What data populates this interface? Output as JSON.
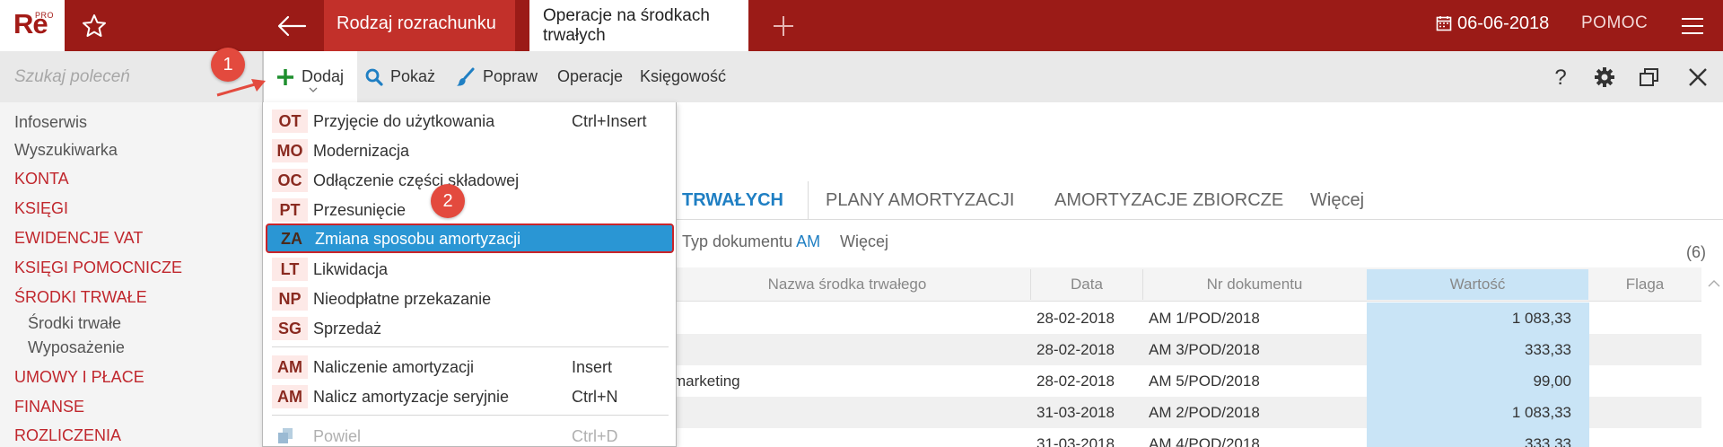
{
  "app": {
    "logo_text": "Re",
    "logo_badge": "PRO",
    "tabs": [
      {
        "label": "Rodzaj rozrachunku"
      },
      {
        "label": "Operacje na środkach trwałych"
      }
    ],
    "date": "06-06-2018",
    "help_label": "POMOC",
    "accent_color": "#9b1b17"
  },
  "toolbar": {
    "search_placeholder": "Szukaj poleceń",
    "add_label": "Dodaj",
    "show_label": "Pokaż",
    "edit_label": "Popraw",
    "operations_label": "Operacje",
    "accounting_label": "Księgowość"
  },
  "sidebar": {
    "items": [
      {
        "label": "Infoserwis"
      },
      {
        "label": "Wyszukiwarka"
      },
      {
        "label": "KONTA"
      },
      {
        "label": "KSIĘGI"
      },
      {
        "label": "EWIDENCJE VAT"
      },
      {
        "label": "KSIĘGI POMOCNICZE"
      },
      {
        "label": "ŚRODKI TRWAŁE"
      },
      {
        "label": "Środki trwałe"
      },
      {
        "label": "Wyposażenie"
      },
      {
        "label": "UMOWY I PŁACE"
      },
      {
        "label": "FINANSE"
      },
      {
        "label": "ROZLICZENIA"
      }
    ]
  },
  "view": {
    "tabs": [
      {
        "label": "H TRWAŁYCH"
      },
      {
        "label": "PLANY AMORTYZACJI"
      },
      {
        "label": "AMORTYZACJE ZBIORCZE"
      },
      {
        "label": "Więcej"
      }
    ],
    "filter_label": "Typ dokumentu",
    "filter_value": "AM",
    "filter_more": "Więcej",
    "count": "(6)"
  },
  "table": {
    "columns": [
      "Nazwa środka trwałego",
      "Data",
      "Nr dokumentu",
      "Wartość",
      "Flaga"
    ],
    "rows": [
      {
        "name": "",
        "date": "28-02-2018",
        "doc": "AM 1/POD/2018",
        "value": "1 083,33",
        "flag": ""
      },
      {
        "name": "",
        "date": "28-02-2018",
        "doc": "AM 3/POD/2018",
        "value": "333,33",
        "flag": ""
      },
      {
        "name": "marketing",
        "date": "28-02-2018",
        "doc": "AM 5/POD/2018",
        "value": "99,00",
        "flag": ""
      },
      {
        "name": "",
        "date": "31-03-2018",
        "doc": "AM 2/POD/2018",
        "value": "1 083,33",
        "flag": ""
      },
      {
        "name": "",
        "date": "31-03-2018",
        "doc": "AM 4/POD/2018",
        "value": "333,33",
        "flag": ""
      }
    ]
  },
  "dropdown": {
    "items": [
      {
        "code": "OT",
        "label": "Przyjęcie do użytkowania",
        "shortcut": "Ctrl+Insert"
      },
      {
        "code": "MO",
        "label": "Modernizacja",
        "shortcut": ""
      },
      {
        "code": "OC",
        "label": "Odłączenie części składowej",
        "shortcut": ""
      },
      {
        "code": "PT",
        "label": "Przesunięcie",
        "shortcut": ""
      },
      {
        "code": "ZA",
        "label": "Zmiana sposobu amortyzacji",
        "shortcut": ""
      },
      {
        "code": "LT",
        "label": "Likwidacja",
        "shortcut": ""
      },
      {
        "code": "NP",
        "label": "Nieodpłatne przekazanie",
        "shortcut": ""
      },
      {
        "code": "SG",
        "label": "Sprzedaż",
        "shortcut": ""
      },
      {
        "code": "AM",
        "label": "Naliczenie amortyzacji",
        "shortcut": "Insert"
      },
      {
        "code": "AM",
        "label": "Nalicz amortyzacje seryjnie",
        "shortcut": "Ctrl+N"
      },
      {
        "code": "",
        "label": "Powiel",
        "shortcut": "Ctrl+D"
      }
    ],
    "highlight_color": "#2a96d4"
  },
  "callouts": [
    "1",
    "2"
  ]
}
